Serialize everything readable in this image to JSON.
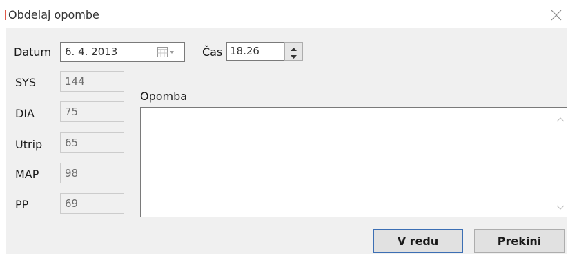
{
  "window": {
    "title": "Obdelaj opombe"
  },
  "form": {
    "date_label": "Datum",
    "date_value": "6. 4. 2013",
    "time_label": "Čas",
    "time_value": "18.26",
    "note_label": "Opomba",
    "note_value": "",
    "fields": [
      {
        "label": "SYS",
        "value": "144"
      },
      {
        "label": "DIA",
        "value": "75"
      },
      {
        "label": "Utrip",
        "value": "65"
      },
      {
        "label": "MAP",
        "value": "98"
      },
      {
        "label": "PP",
        "value": "69"
      }
    ]
  },
  "buttons": {
    "ok_label": "V redu",
    "cancel_label": "Prekini"
  },
  "icons": {
    "close": "close-icon",
    "calendar": "calendar-icon",
    "spin_up": "spin-up-icon",
    "spin_down": "spin-down-icon",
    "scroll_up": "scroll-up-icon",
    "scroll_down": "scroll-down-icon"
  },
  "colors": {
    "accent": "#e05a4a",
    "focus_border": "#3c6fb4",
    "client_bg": "#f0f0f0"
  }
}
